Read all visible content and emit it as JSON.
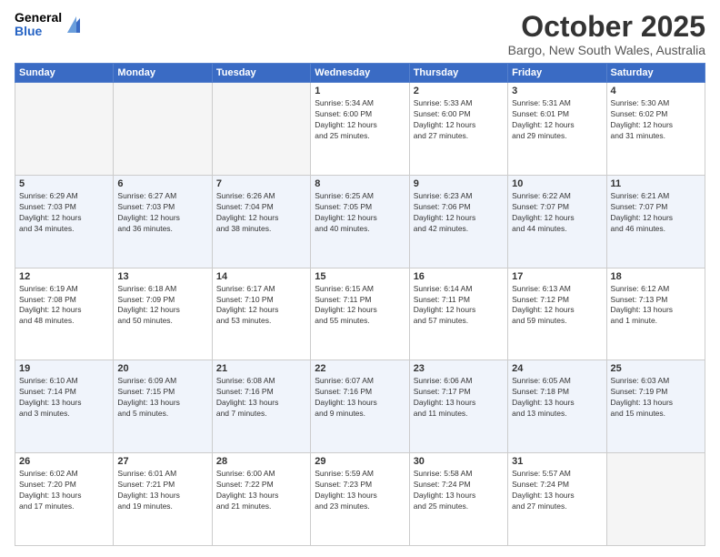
{
  "header": {
    "logo_general": "General",
    "logo_blue": "Blue",
    "month_title": "October 2025",
    "subtitle": "Bargo, New South Wales, Australia"
  },
  "days_of_week": [
    "Sunday",
    "Monday",
    "Tuesday",
    "Wednesday",
    "Thursday",
    "Friday",
    "Saturday"
  ],
  "weeks": [
    [
      {
        "day": "",
        "info": ""
      },
      {
        "day": "",
        "info": ""
      },
      {
        "day": "",
        "info": ""
      },
      {
        "day": "1",
        "info": "Sunrise: 5:34 AM\nSunset: 6:00 PM\nDaylight: 12 hours\nand 25 minutes."
      },
      {
        "day": "2",
        "info": "Sunrise: 5:33 AM\nSunset: 6:00 PM\nDaylight: 12 hours\nand 27 minutes."
      },
      {
        "day": "3",
        "info": "Sunrise: 5:31 AM\nSunset: 6:01 PM\nDaylight: 12 hours\nand 29 minutes."
      },
      {
        "day": "4",
        "info": "Sunrise: 5:30 AM\nSunset: 6:02 PM\nDaylight: 12 hours\nand 31 minutes."
      }
    ],
    [
      {
        "day": "5",
        "info": "Sunrise: 6:29 AM\nSunset: 7:03 PM\nDaylight: 12 hours\nand 34 minutes."
      },
      {
        "day": "6",
        "info": "Sunrise: 6:27 AM\nSunset: 7:03 PM\nDaylight: 12 hours\nand 36 minutes."
      },
      {
        "day": "7",
        "info": "Sunrise: 6:26 AM\nSunset: 7:04 PM\nDaylight: 12 hours\nand 38 minutes."
      },
      {
        "day": "8",
        "info": "Sunrise: 6:25 AM\nSunset: 7:05 PM\nDaylight: 12 hours\nand 40 minutes."
      },
      {
        "day": "9",
        "info": "Sunrise: 6:23 AM\nSunset: 7:06 PM\nDaylight: 12 hours\nand 42 minutes."
      },
      {
        "day": "10",
        "info": "Sunrise: 6:22 AM\nSunset: 7:07 PM\nDaylight: 12 hours\nand 44 minutes."
      },
      {
        "day": "11",
        "info": "Sunrise: 6:21 AM\nSunset: 7:07 PM\nDaylight: 12 hours\nand 46 minutes."
      }
    ],
    [
      {
        "day": "12",
        "info": "Sunrise: 6:19 AM\nSunset: 7:08 PM\nDaylight: 12 hours\nand 48 minutes."
      },
      {
        "day": "13",
        "info": "Sunrise: 6:18 AM\nSunset: 7:09 PM\nDaylight: 12 hours\nand 50 minutes."
      },
      {
        "day": "14",
        "info": "Sunrise: 6:17 AM\nSunset: 7:10 PM\nDaylight: 12 hours\nand 53 minutes."
      },
      {
        "day": "15",
        "info": "Sunrise: 6:15 AM\nSunset: 7:11 PM\nDaylight: 12 hours\nand 55 minutes."
      },
      {
        "day": "16",
        "info": "Sunrise: 6:14 AM\nSunset: 7:11 PM\nDaylight: 12 hours\nand 57 minutes."
      },
      {
        "day": "17",
        "info": "Sunrise: 6:13 AM\nSunset: 7:12 PM\nDaylight: 12 hours\nand 59 minutes."
      },
      {
        "day": "18",
        "info": "Sunrise: 6:12 AM\nSunset: 7:13 PM\nDaylight: 13 hours\nand 1 minute."
      }
    ],
    [
      {
        "day": "19",
        "info": "Sunrise: 6:10 AM\nSunset: 7:14 PM\nDaylight: 13 hours\nand 3 minutes."
      },
      {
        "day": "20",
        "info": "Sunrise: 6:09 AM\nSunset: 7:15 PM\nDaylight: 13 hours\nand 5 minutes."
      },
      {
        "day": "21",
        "info": "Sunrise: 6:08 AM\nSunset: 7:16 PM\nDaylight: 13 hours\nand 7 minutes."
      },
      {
        "day": "22",
        "info": "Sunrise: 6:07 AM\nSunset: 7:16 PM\nDaylight: 13 hours\nand 9 minutes."
      },
      {
        "day": "23",
        "info": "Sunrise: 6:06 AM\nSunset: 7:17 PM\nDaylight: 13 hours\nand 11 minutes."
      },
      {
        "day": "24",
        "info": "Sunrise: 6:05 AM\nSunset: 7:18 PM\nDaylight: 13 hours\nand 13 minutes."
      },
      {
        "day": "25",
        "info": "Sunrise: 6:03 AM\nSunset: 7:19 PM\nDaylight: 13 hours\nand 15 minutes."
      }
    ],
    [
      {
        "day": "26",
        "info": "Sunrise: 6:02 AM\nSunset: 7:20 PM\nDaylight: 13 hours\nand 17 minutes."
      },
      {
        "day": "27",
        "info": "Sunrise: 6:01 AM\nSunset: 7:21 PM\nDaylight: 13 hours\nand 19 minutes."
      },
      {
        "day": "28",
        "info": "Sunrise: 6:00 AM\nSunset: 7:22 PM\nDaylight: 13 hours\nand 21 minutes."
      },
      {
        "day": "29",
        "info": "Sunrise: 5:59 AM\nSunset: 7:23 PM\nDaylight: 13 hours\nand 23 minutes."
      },
      {
        "day": "30",
        "info": "Sunrise: 5:58 AM\nSunset: 7:24 PM\nDaylight: 13 hours\nand 25 minutes."
      },
      {
        "day": "31",
        "info": "Sunrise: 5:57 AM\nSunset: 7:24 PM\nDaylight: 13 hours\nand 27 minutes."
      },
      {
        "day": "",
        "info": ""
      }
    ]
  ]
}
